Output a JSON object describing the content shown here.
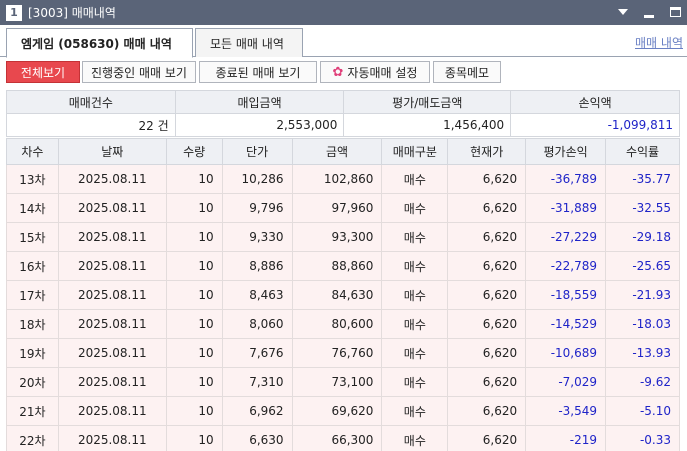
{
  "window": {
    "number": "1",
    "title": "[3003] 매매내역"
  },
  "main_tabs": [
    {
      "label": "엠게임 (058630) 매매 내역"
    },
    {
      "label": "모든 매매 내역"
    }
  ],
  "link_right": "매매 내역",
  "sub_buttons": [
    {
      "label": "전체보기"
    },
    {
      "label": "진행중인 매매 보기"
    },
    {
      "label": "종료된 매매 보기"
    },
    {
      "label": "자동매매 설정"
    },
    {
      "label": "종목메모"
    }
  ],
  "summary": {
    "headers": [
      "매매건수",
      "매입금액",
      "평가/매도금액",
      "손익액"
    ],
    "values": [
      "22 건",
      "2,553,000",
      "1,456,400",
      "-1,099,811"
    ]
  },
  "detail": {
    "headers": [
      "차수",
      "날짜",
      "수량",
      "단가",
      "금액",
      "매매구분",
      "현재가",
      "평가손익",
      "수익률"
    ],
    "rows": [
      [
        "13차",
        "2025.08.11",
        "10",
        "10,286",
        "102,860",
        "매수",
        "6,620",
        "-36,789",
        "-35.77"
      ],
      [
        "14차",
        "2025.08.11",
        "10",
        "9,796",
        "97,960",
        "매수",
        "6,620",
        "-31,889",
        "-32.55"
      ],
      [
        "15차",
        "2025.08.11",
        "10",
        "9,330",
        "93,300",
        "매수",
        "6,620",
        "-27,229",
        "-29.18"
      ],
      [
        "16차",
        "2025.08.11",
        "10",
        "8,886",
        "88,860",
        "매수",
        "6,620",
        "-22,789",
        "-25.65"
      ],
      [
        "17차",
        "2025.08.11",
        "10",
        "8,463",
        "84,630",
        "매수",
        "6,620",
        "-18,559",
        "-21.93"
      ],
      [
        "18차",
        "2025.08.11",
        "10",
        "8,060",
        "80,600",
        "매수",
        "6,620",
        "-14,529",
        "-18.03"
      ],
      [
        "19차",
        "2025.08.11",
        "10",
        "7,676",
        "76,760",
        "매수",
        "6,620",
        "-10,689",
        "-13.93"
      ],
      [
        "20차",
        "2025.08.11",
        "10",
        "7,310",
        "73,100",
        "매수",
        "6,620",
        "-7,029",
        "-9.62"
      ],
      [
        "21차",
        "2025.08.11",
        "10",
        "6,962",
        "69,620",
        "매수",
        "6,620",
        "-3,549",
        "-5.10"
      ],
      [
        "22차",
        "2025.08.11",
        "10",
        "6,630",
        "66,300",
        "매수",
        "6,620",
        "-219",
        "-0.33"
      ]
    ]
  },
  "colors": {
    "titlebar": "#5a6478",
    "active_button": "#e8484e",
    "negative": "#1f24c8",
    "row_bg": "#fdf2f2"
  }
}
